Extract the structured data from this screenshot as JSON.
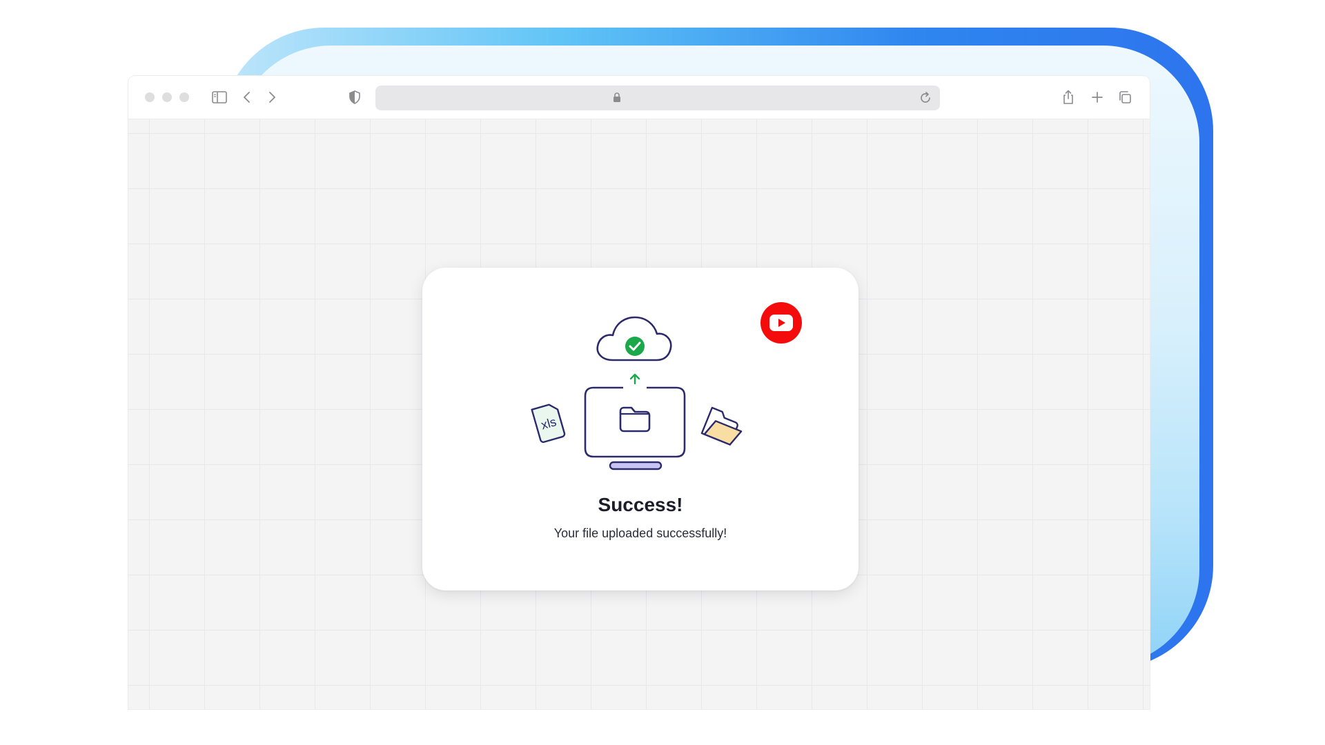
{
  "browser": {
    "address": ""
  },
  "toolbar_icons": [
    "sidebar-toggle-icon",
    "back-icon",
    "forward-icon",
    "shield-icon",
    "lock-icon",
    "reload-icon",
    "share-icon",
    "new-tab-icon",
    "tabs-overview-icon"
  ],
  "modal": {
    "title": "Success!",
    "message": "Your file uploaded successfully!",
    "illustration": {
      "file_badge_text": "xls",
      "icons": [
        "cloud-check-icon",
        "upload-arrow-icon",
        "computer-monitor-icon",
        "folder-icon",
        "xls-file-icon",
        "open-folder-icon"
      ]
    },
    "badge_icon": "youtube-play-icon"
  },
  "colors": {
    "success_green": "#1aa84a",
    "outline_navy": "#2b2a6b",
    "stand_lavender": "#c9c4f4",
    "folder_yellow": "#f9dea4",
    "youtube_red": "#f40c0c",
    "accent_blue": "#2d74ee"
  }
}
